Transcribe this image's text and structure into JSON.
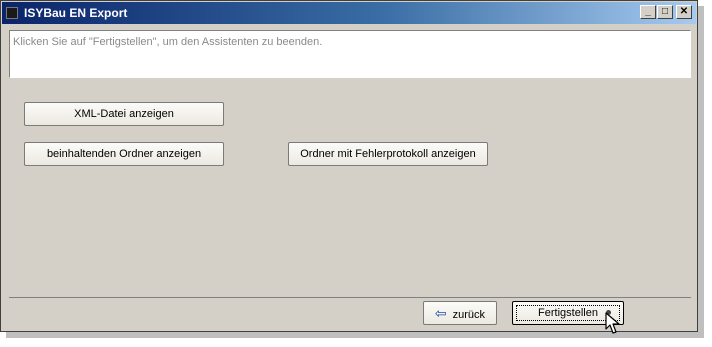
{
  "window": {
    "title": "ISYBau EN Export",
    "minimize": "_",
    "maximize": "□",
    "close": "✕"
  },
  "message": "Klicken Sie auf \"Fertigstellen\", um den Assistenten zu beenden.",
  "buttons": {
    "xml": "XML-Datei anzeigen",
    "folder": "beinhaltenden Ordner anzeigen",
    "errorlog": "Ordner mit Fehlerprotokoll anzeigen"
  },
  "footer": {
    "back": "zurück",
    "finish": "Fertigstellen"
  },
  "icons": {
    "back": "arrow-left-icon",
    "cursor": "mouse-pointer-icon"
  }
}
